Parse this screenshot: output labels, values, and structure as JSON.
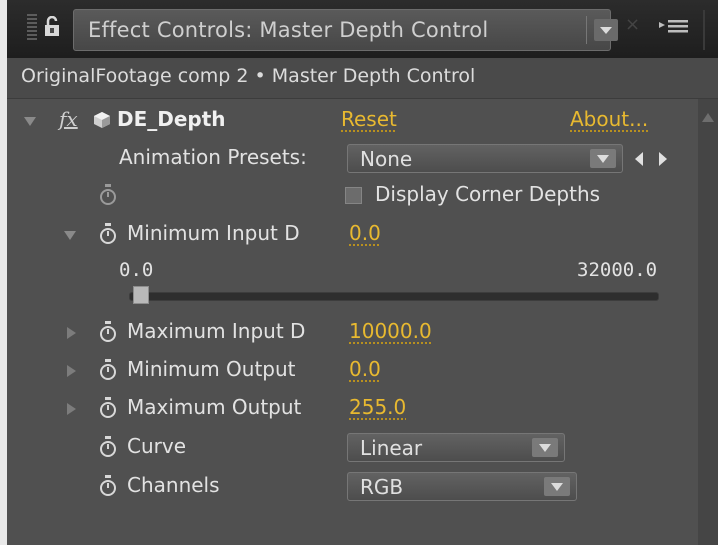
{
  "panel": {
    "tab_title": "Effect Controls: Master Depth Control",
    "tab_close": "×",
    "breadcrumb": "OriginalFootage comp 2 • Master Depth Control"
  },
  "effect": {
    "fx_label": "fx",
    "name": "DE_Depth",
    "reset": "Reset",
    "about": "About...",
    "animation_presets_label": "Animation Presets:",
    "animation_presets_value": "None"
  },
  "properties": {
    "display_corner_depths": {
      "label": "Display Corner Depths",
      "checked": false
    },
    "minimum_input": {
      "label": "Minimum Input D",
      "value": "0.0",
      "slider_min": "0.0",
      "slider_max": "32000.0",
      "slider_fraction": 0.0
    },
    "maximum_input": {
      "label": "Maximum Input D",
      "value": "10000.0"
    },
    "minimum_output": {
      "label": "Minimum Output",
      "value": "0.0"
    },
    "maximum_output": {
      "label": "Maximum Output",
      "value": "255.0"
    },
    "curve": {
      "label": "Curve",
      "value": "Linear"
    },
    "channels": {
      "label": "Channels",
      "value": "RGB"
    }
  },
  "colors": {
    "panel_bg": "#505050",
    "value_accent": "#e8b930",
    "tab_bar": "#262626"
  },
  "icons": [
    "lock-icon",
    "menu-icon",
    "fx-icon",
    "effect-icon",
    "stopwatch-icon",
    "twirl-icon",
    "dropdown-arrow-icon",
    "scroll-up-icon"
  ]
}
